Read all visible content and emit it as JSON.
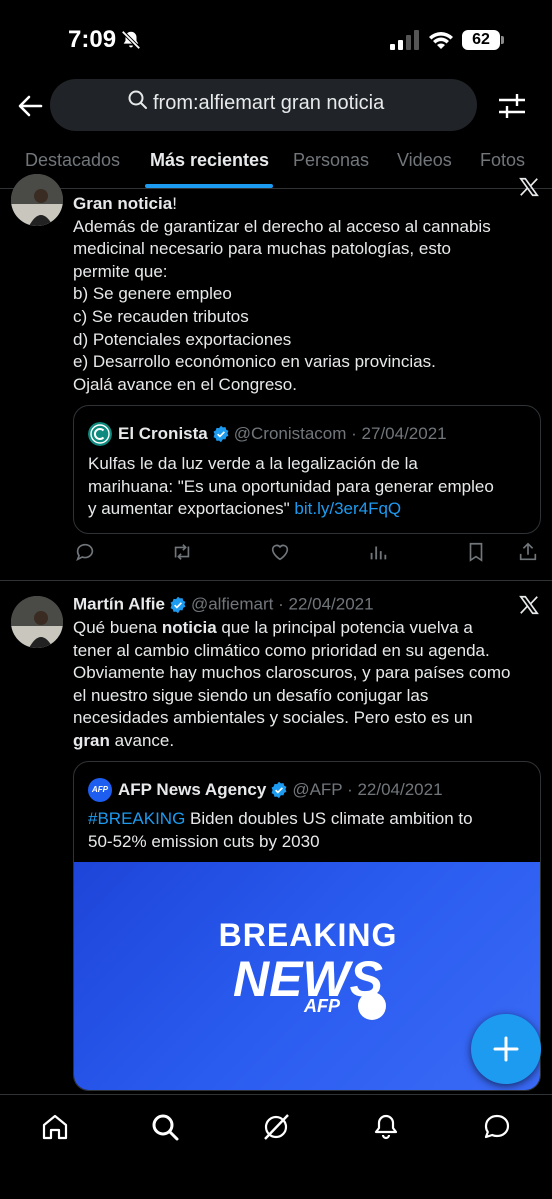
{
  "status_bar": {
    "time": "7:09",
    "battery": "62"
  },
  "search": {
    "query": "from:alfiemart gran noticia"
  },
  "tabs": [
    {
      "label": "Destacados"
    },
    {
      "label": "Más recientes"
    },
    {
      "label": "Personas"
    },
    {
      "label": "Videos"
    },
    {
      "label": "Fotos"
    }
  ],
  "tweet1": {
    "title_bold": "Gran noticia",
    "title_rest": "!",
    "lines": [
      "Además de garantizar el derecho al acceso al cannabis",
      "medicinal necesario para muchas patologías, esto",
      "permite que:",
      "b) Se genere empleo",
      "c) Se recauden tributos",
      "d) Potenciales exportaciones",
      "e) Desarrollo económonico en varias provincias.",
      "Ojalá avance en el Congreso."
    ],
    "quote": {
      "name": "El Cronista",
      "handle": "@Cronistacom · 27/04/2021",
      "lines": [
        "Kulfas le da luz verde a la legalización de la",
        "marihuana: \"Es una oportunidad para generar empleo",
        "y aumentar exportaciones\""
      ],
      "link": "bit.ly/3er4FqQ"
    }
  },
  "tweet2": {
    "name": "Martín Alfie",
    "handle": "@alfiemart · 22/04/2021",
    "text": {
      "l1_a": "Qué buena ",
      "l1_b": "noticia",
      "l1_c": " que la principal potencia vuelva a",
      "l2": "tener al cambio climático como prioridad en su agenda.",
      "l3": "Obviamente hay muchos claroscuros, y para países como",
      "l4": "el nuestro sigue siendo un desafío conjugar las",
      "l5": "necesidades ambientales y sociales. Pero esto es un",
      "l6_b": "gran",
      "l6_c": " avance."
    },
    "quote": {
      "name": "AFP News Agency",
      "handle": "@AFP · 22/04/2021",
      "hashtag": "#BREAKING",
      "l1_rest": " Biden doubles US climate ambition to",
      "l2": "50-52% emission cuts by 2030",
      "image_line1": "BREAKING",
      "image_line2": "NEWS",
      "image_brand": "AFP",
      "avatar_text": "AFP"
    }
  },
  "colors": {
    "accent": "#1d9bf0",
    "background": "#000000",
    "muted": "#71767b",
    "text": "#e7e9ea"
  }
}
